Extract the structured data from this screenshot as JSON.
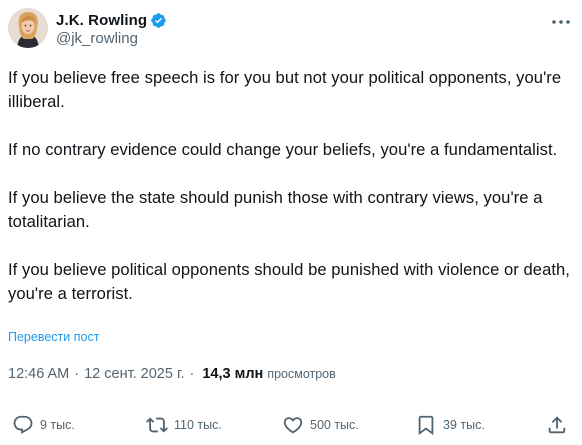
{
  "author": {
    "name": "J.K. Rowling",
    "handle": "@jk_rowling"
  },
  "tweet": {
    "paragraphs": [
      "If you believe free speech is for you but not your political opponents, you're illiberal.",
      "If no contrary evidence could change your beliefs, you're a fundamentalist.",
      "If you believe the state should punish those with contrary views, you're a totalitarian.",
      "If you believe political opponents should be punished with violence or death, you're a terrorist."
    ],
    "translate_label": "Перевести пост"
  },
  "meta": {
    "time": "12:46 AM",
    "separator": "·",
    "date": "12 сент. 2025 г.",
    "separator2": "·",
    "views_count": "14,3 млн",
    "views_label": "просмотров"
  },
  "actions": {
    "replies": "9 тыс.",
    "reposts": "110 тыс.",
    "likes": "500 тыс.",
    "bookmarks": "39 тыс."
  },
  "icons": {
    "verified": "verified-badge-icon",
    "more": "more-icon",
    "reply": "reply-icon",
    "repost": "repost-icon",
    "like": "heart-icon",
    "bookmark": "bookmark-icon",
    "share": "share-icon"
  },
  "colors": {
    "text": "#0f1419",
    "secondary": "#536471",
    "accent": "#1d9bf0"
  }
}
